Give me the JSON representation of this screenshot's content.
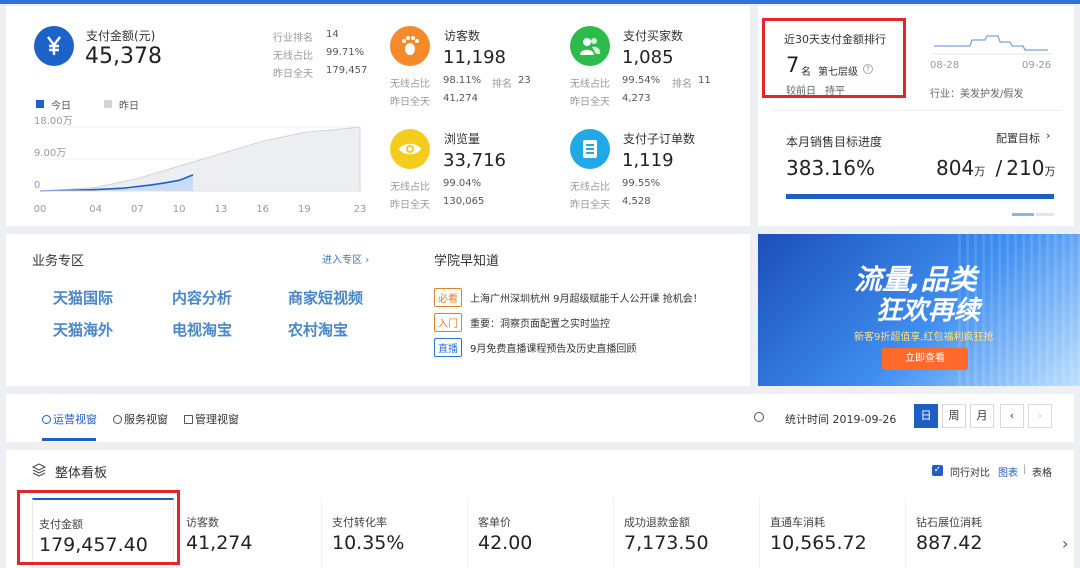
{
  "colors": {
    "accent": "#2f73d8",
    "highlight_box": "#e0282c",
    "blue_icon": "#1c62c8",
    "orange_icon": "#f58a2b",
    "green_icon": "#2dbb4c",
    "yellow_icon": "#f4cc1e",
    "cyan_icon": "#21a8e6"
  },
  "realtime": {
    "pay": {
      "icon": "yen-icon",
      "label": "支付金额(元)",
      "value": "45,378",
      "industry_rank_label": "行业排名",
      "industry_rank": "14",
      "wireless_label": "无线占比",
      "wireless": "99.71%",
      "yesterday_label": "昨日全天",
      "yesterday": "179,457"
    },
    "legend": {
      "today": "今日",
      "yesterday": "昨日"
    },
    "chart_data": {
      "type": "area",
      "y_ticks": [
        "18.00万",
        "9.00万",
        "0"
      ],
      "x_ticks": [
        "00",
        "04",
        "07",
        "10",
        "13",
        "16",
        "19",
        "23"
      ],
      "ylim": [
        0,
        180000
      ],
      "series": [
        {
          "name": "今日",
          "x": [
            0,
            2,
            4,
            6,
            8,
            9,
            10,
            11
          ],
          "values": [
            0,
            1500,
            4000,
            8000,
            17000,
            23000,
            30000,
            45378
          ]
        },
        {
          "name": "昨日",
          "x": [
            0,
            4,
            7,
            10,
            13,
            16,
            19,
            23
          ],
          "values": [
            0,
            10000,
            35000,
            70000,
            105000,
            140000,
            165000,
            179457
          ]
        }
      ]
    },
    "visitors": {
      "icon": "footprint-icon",
      "label": "访客数",
      "value": "11,198",
      "wireless_label": "无线占比",
      "wireless": "98.11%",
      "rank_label": "排名",
      "rank": "23",
      "yesterday_label": "昨日全天",
      "yesterday": "41,274"
    },
    "buyers": {
      "icon": "user-group-icon",
      "label": "支付买家数",
      "value": "1,085",
      "wireless_label": "无线占比",
      "wireless": "99.54%",
      "rank_label": "排名",
      "rank": "11",
      "yesterday_label": "昨日全天",
      "yesterday": "4,273"
    },
    "pageviews": {
      "icon": "eye-icon",
      "label": "浏览量",
      "value": "33,716",
      "wireless_label": "无线占比",
      "wireless": "99.04%",
      "yesterday_label": "昨日全天",
      "yesterday": "130,065"
    },
    "suborders": {
      "icon": "order-list-icon",
      "label": "支付子订单数",
      "value": "1,119",
      "wireless_label": "无线占比",
      "wireless": "99.55%",
      "yesterday_label": "昨日全天",
      "yesterday": "4,528"
    }
  },
  "ranking": {
    "title": "近30天支付金额排行",
    "rank": "7",
    "rank_unit": "名",
    "tier": "第七层级",
    "compare_label": "较前日",
    "compare_value": "持平",
    "trend_start": "08-28",
    "trend_end": "09-26",
    "industry": "行业：美发护发/假发"
  },
  "sales_target": {
    "title": "本月销售目标进度",
    "config_link": "配置目标",
    "percent": "383.16%",
    "actual": "804",
    "actual_unit": "万",
    "separator": "/",
    "target": "210",
    "target_unit": "万",
    "progress": 1.0
  },
  "business_zone": {
    "title": "业务专区",
    "enter_link": "进入专区",
    "links": [
      "天猫国际",
      "内容分析",
      "商家短视频",
      "天猫海外",
      "电视淘宝",
      "农村淘宝"
    ]
  },
  "academy": {
    "title": "学院早知道",
    "items": [
      {
        "tag": "必看",
        "text": "上海广州深圳杭州 9月超级赋能千人公开课 抢机会！"
      },
      {
        "tag": "入门",
        "text": "重要：洞察页面配置之实时监控"
      },
      {
        "tag": "直播",
        "text": "9月免费直播课程预告及历史直播回顾"
      }
    ]
  },
  "banner": {
    "line1": "流量,品类",
    "line2": "狂欢再续",
    "sub": "新客9折超值享,红包福利疯狂抢",
    "button": "立即查看"
  },
  "view_tabs": {
    "tabs": [
      "运营视窗",
      "服务视窗",
      "管理视窗"
    ],
    "stat_time": "统计时间 2019-09-26",
    "periods": [
      "日",
      "周",
      "月"
    ]
  },
  "overview": {
    "title": "整体看板",
    "compare_label": "同行对比",
    "view_chart": "图表",
    "divider": "|",
    "view_table": "表格",
    "metrics": [
      {
        "label": "支付金额",
        "value": "179,457.40"
      },
      {
        "label": "访客数",
        "value": "41,274"
      },
      {
        "label": "支付转化率",
        "value": "10.35%"
      },
      {
        "label": "客单价",
        "value": "42.00"
      },
      {
        "label": "成功退款金额",
        "value": "7,173.50"
      },
      {
        "label": "直通车消耗",
        "value": "10,565.72"
      },
      {
        "label": "钻石展位消耗",
        "value": "887.42"
      }
    ]
  }
}
